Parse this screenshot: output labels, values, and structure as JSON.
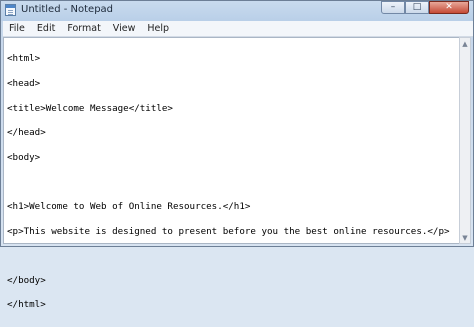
{
  "window": {
    "title": "Untitled - Notepad",
    "controls": {
      "minimize": "–",
      "maximize": "□",
      "close": "✕"
    }
  },
  "menu": [
    "File",
    "Edit",
    "Format",
    "View",
    "Help"
  ],
  "editor": {
    "lines": [
      "<html>",
      "<head>",
      "<title>Welcome Message</title>",
      "</head>",
      "<body>",
      "",
      "<h1>Welcome to Web of Online Resources.</h1>",
      "<p>This website is designed to present before you the best online resources.</p>",
      "",
      "</body>",
      "</html>"
    ]
  },
  "scrollbar": {
    "up": "▲",
    "down": "▼"
  }
}
